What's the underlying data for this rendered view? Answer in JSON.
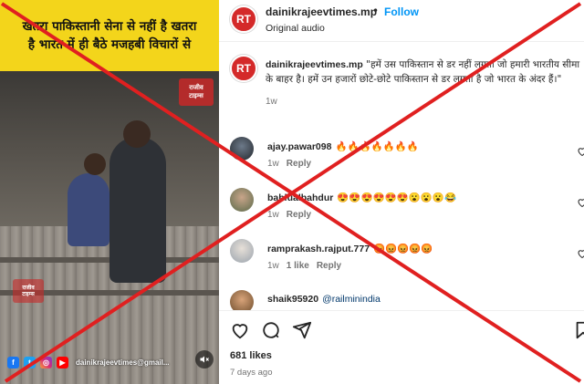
{
  "video": {
    "banner_line1": "खतरा पाकिस्तानी सेना से नहीं है  खतरा",
    "banner_line2": "है भारत में ही बैठे मजहबी विचारों से",
    "watermark_line1": "राजीव",
    "watermark_line2": "टाइम्स",
    "footer_email": "dainikrajeevtimes@gmail...",
    "social_icons": [
      "facebook-icon",
      "twitter-icon",
      "instagram-icon",
      "youtube-icon"
    ]
  },
  "post": {
    "username": "dainikrajeevtimes.mp",
    "dot": "•",
    "follow_label": "Follow",
    "audio": "Original audio",
    "caption_user": "dainikrajeevtimes.mp",
    "caption_text": "\"हमें उस पाकिस्तान से डर नहीं लगता जो हमारी भारतीय सीमा के बाहर है। हमें उन हजारों छोटे-छोटे पाकिस्तान से डर लगता है जो भारत के अंदर हैं।\"",
    "caption_time": "1w"
  },
  "comments": [
    {
      "user": "ajay.pawar098",
      "text": "🔥🔥🔥🔥🔥🔥🔥",
      "time": "1w",
      "likes": "",
      "reply": "Reply"
    },
    {
      "user": "bablualbahdur",
      "text": "😍😍😍😍😍😍😮😮😮😂",
      "time": "1w",
      "likes": "",
      "reply": "Reply"
    },
    {
      "user": "ramprakash.rajput.777",
      "text": "😡😡😡😡😡",
      "time": "1w",
      "likes": "1 like",
      "reply": "Reply"
    },
    {
      "user": "shaik95920",
      "text": "@railminindia",
      "time": "",
      "likes": "",
      "reply": ""
    }
  ],
  "footer": {
    "likes": "681 likes",
    "ago": "7 days ago"
  },
  "colors": {
    "follow_blue": "#0095f6",
    "banner_yellow": "#f3d51b",
    "overlay_red": "#e02020",
    "logo_red": "#d42a2a"
  }
}
